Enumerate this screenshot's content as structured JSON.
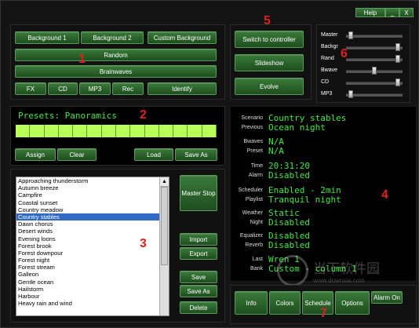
{
  "window": {
    "help_label": "Help",
    "minimize_label": "_",
    "close_label": "X"
  },
  "backgrounds": {
    "background1": "Background 1",
    "background2": "Background 2",
    "custom_background": "Custom Background",
    "random": "Random",
    "brainwaves": "Brainwaves",
    "fx": "FX",
    "cd": "CD",
    "mp3": "MP3",
    "rec": "Rec",
    "identify": "Identify"
  },
  "controls": {
    "switch_to_controller": "Switch to controller",
    "slideshow": "Slideshow",
    "evolve": "Evolve"
  },
  "sliders": [
    {
      "label": "Master",
      "value": 0.05
    },
    {
      "label": "Backgr",
      "value": 0.95
    },
    {
      "label": "Rand",
      "value": 0.95
    },
    {
      "label": "Bwave",
      "value": 0.5
    },
    {
      "label": "CD",
      "value": 0.95
    },
    {
      "label": "MP3",
      "value": 0.05
    }
  ],
  "presets": {
    "title": "Presets: Panoramics",
    "assign": "Assign",
    "clear": "Clear",
    "load": "Load",
    "save_as": "Save As",
    "bar_count": 14
  },
  "sound_list": [
    "Approaching thunderstorm",
    "Autumn breeze",
    "Campfire",
    "Coastal sunset",
    "Country meadow",
    "Country stables",
    "Dawn chorus",
    "Desert winds",
    "Evening loons",
    "Forest brook",
    "Forest downpour",
    "Forest night",
    "Forest stream",
    "Galleon",
    "Gentle ocean",
    "Hailstorm",
    "Harbour",
    "Heavy rain and wind"
  ],
  "selected_index": 5,
  "list_buttons": {
    "master_stop": "Master Stop",
    "import": "Import",
    "export": "Export",
    "save": "Save",
    "save_as": "Save As",
    "delete": "Delete"
  },
  "info": {
    "scenario_label": "Scenario",
    "scenario_value": "Country stables",
    "previous_label": "Previous",
    "previous_value": "Ocean night",
    "bwaves_label": "Bwaves",
    "bwaves_value": "N/A",
    "preset_label": "Preset",
    "preset_value": "N/A",
    "time_label": "Time",
    "time_value": "20:31:20",
    "alarm_label": "Alarm",
    "alarm_value": "Disabled",
    "scheduler_label": "Scheduler",
    "scheduler_value": "Enabled - 2min",
    "playlist_label": "Playlist",
    "playlist_value": "Tranquil night",
    "weather_label": "Weather",
    "weather_value": "Static",
    "night_label": "Night",
    "night_value": "Disabled",
    "equalizer_label": "Equalizer",
    "equalizer_value": "Disabled",
    "reverb_label": "Reverb",
    "reverb_value": "Disabled",
    "last_label": "Last",
    "last_value": "Wren 1",
    "bank_label": "Bank",
    "bank_value": "Custom - column 1"
  },
  "bottom_tabs": {
    "info": "Info",
    "colors": "Colors",
    "schedule": "Schedule",
    "options": "Options",
    "alarm_on": "Alarm On"
  },
  "annotations": {
    "n1": "1",
    "n2": "2",
    "n3": "3",
    "n4": "4",
    "n5": "5",
    "n6": "6",
    "n7": "7"
  },
  "watermark": {
    "line1": "当下软件园",
    "line2": "www.downxia.com"
  },
  "colors": {
    "accent_green": "#3eea3e",
    "preset_bar": "#b8ff5a",
    "selection": "#316ac5",
    "annotation_red": "#e02020"
  }
}
